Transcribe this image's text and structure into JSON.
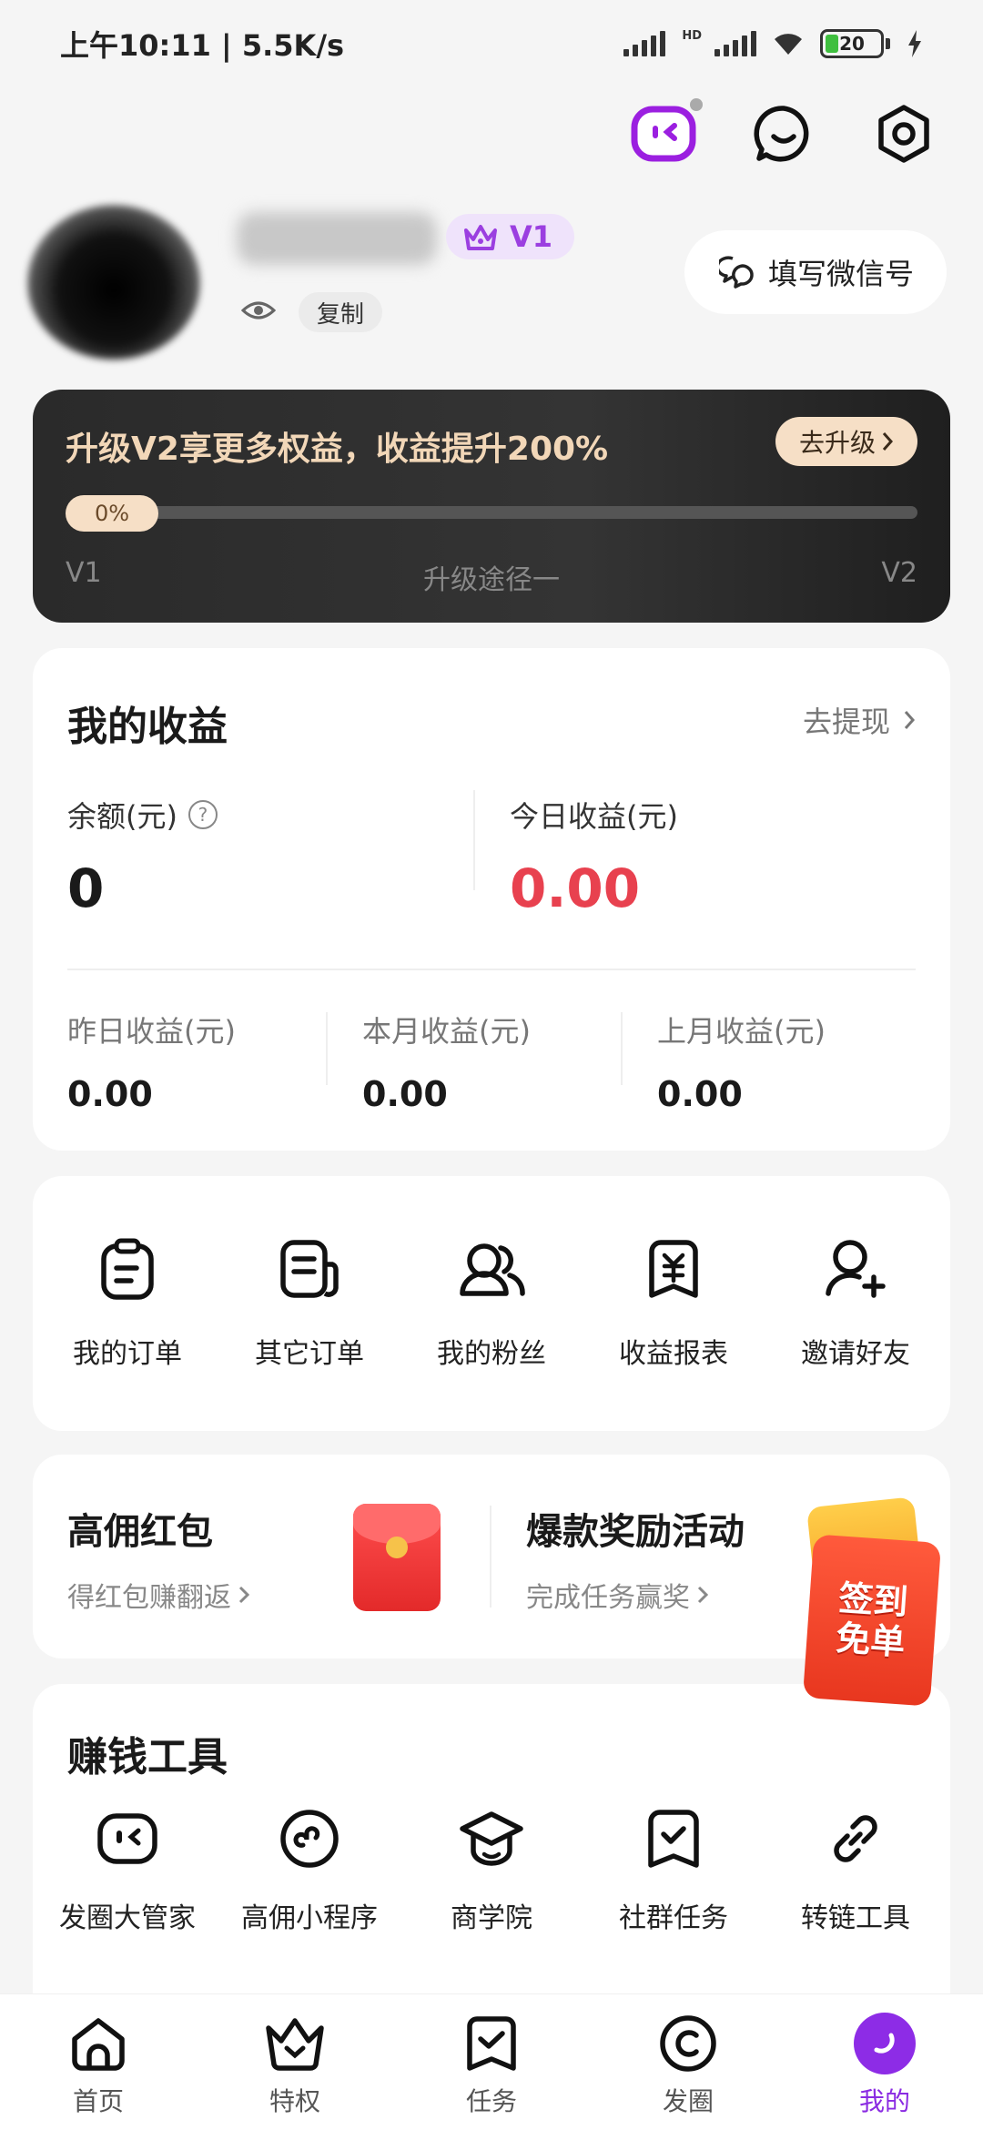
{
  "status_bar": {
    "time_speed": "上午10:11 | 5.5K/s",
    "network_label": "HD",
    "battery": "20"
  },
  "profile": {
    "level_badge": "V1",
    "copy_label": "复制",
    "wechat_button": "填写微信号"
  },
  "upgrade": {
    "title": "升级V2享更多权益，收益提升200%",
    "button": "去升级",
    "progress_label": "0%",
    "progress": 0,
    "level_from": "V1",
    "path_label": "升级途径一",
    "level_to": "V2"
  },
  "earnings": {
    "title": "我的收益",
    "withdraw": "去提现",
    "balance_label": "余额(元)",
    "balance_value": "0",
    "today_label": "今日收益(元)",
    "today_value": "0.00",
    "yesterday_label": "昨日收益(元)",
    "yesterday_value": "0.00",
    "month_label": "本月收益(元)",
    "month_value": "0.00",
    "last_month_label": "上月收益(元)",
    "last_month_value": "0.00"
  },
  "orders": {
    "items": [
      {
        "label": "我的订单",
        "icon": "order-icon"
      },
      {
        "label": "其它订单",
        "icon": "other-orders-icon"
      },
      {
        "label": "我的粉丝",
        "icon": "fans-icon"
      },
      {
        "label": "收益报表",
        "icon": "report-icon"
      },
      {
        "label": "邀请好友",
        "icon": "invite-icon"
      }
    ]
  },
  "promo": {
    "left_title": "高佣红包",
    "left_sub": "得红包赚翻返",
    "right_title": "爆款奖励活动",
    "right_sub": "完成任务赢奖",
    "float_badge": "签到\n免单"
  },
  "tools": {
    "title": "赚钱工具",
    "items": [
      {
        "label": "发圈大管家",
        "icon": "robot-icon"
      },
      {
        "label": "高佣小程序",
        "icon": "mini-program-icon"
      },
      {
        "label": "商学院",
        "icon": "graduation-cap-icon"
      },
      {
        "label": "社群任务",
        "icon": "task-check-icon"
      },
      {
        "label": "转链工具",
        "icon": "link-icon"
      }
    ]
  },
  "tabbar": {
    "items": [
      {
        "label": "首页",
        "icon": "home-icon"
      },
      {
        "label": "特权",
        "icon": "crown-icon"
      },
      {
        "label": "任务",
        "icon": "task-icon"
      },
      {
        "label": "发圈",
        "icon": "moments-icon"
      },
      {
        "label": "我的",
        "icon": "profile-icon"
      }
    ],
    "active_color": "#8a2be2"
  },
  "colors": {
    "accent_purple": "#8d2ce6",
    "earnings_red": "#e8414f",
    "gold_text": "#f2d7b8"
  }
}
